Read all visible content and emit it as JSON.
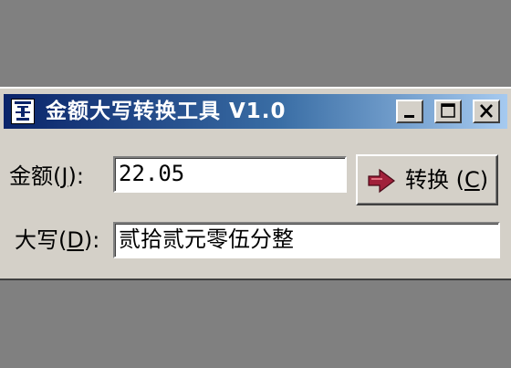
{
  "window": {
    "title": "金额大写转换工具 V1.0",
    "icon": "app-icon",
    "controls": [
      "minimize-icon",
      "maximize-icon",
      "close-icon"
    ]
  },
  "amount": {
    "label_prefix": "金额",
    "mnemonic": "J",
    "label_suffix": ":",
    "value": "22.05"
  },
  "uppercase": {
    "label_prefix": "大写",
    "mnemonic": "D",
    "label_suffix": ":",
    "value": "贰拾贰元零伍分整"
  },
  "convert_button": {
    "label": "转换",
    "mnemonic": "C",
    "icon": "right-arrow-icon"
  },
  "colors": {
    "titlebar_start": "#0a246a",
    "titlebar_end": "#a6caf0",
    "face": "#d4d0c8",
    "arrow": "#a0203a"
  }
}
